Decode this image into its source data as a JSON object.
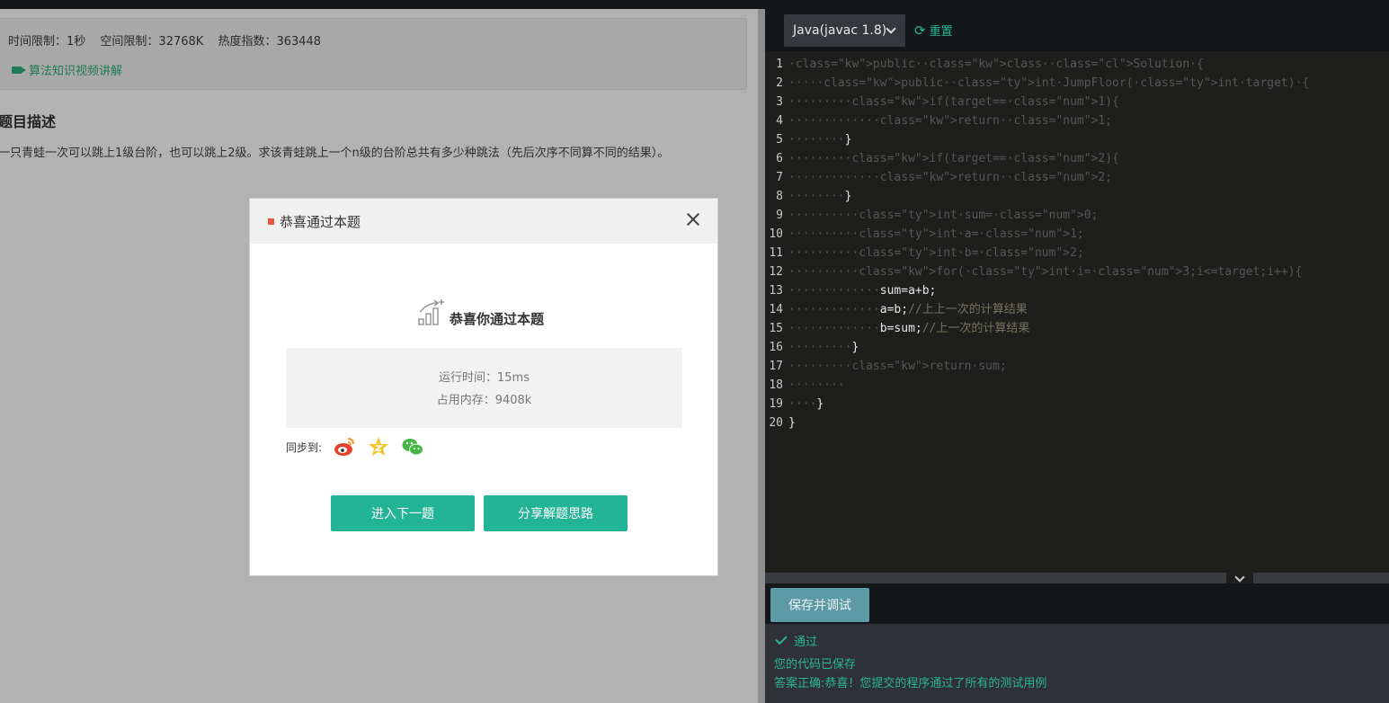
{
  "problem": {
    "time_limit": "时间限制：1秒",
    "space_limit": "空间限制：32768K",
    "heat": "热度指数：363448",
    "video_link": "算法知识视频讲解",
    "desc_title": "题目描述",
    "desc_text": "一只青蛙一次可以跳上1级台阶，也可以跳上2级。求该青蛙跳上一个n级的台阶总共有多少种跳法（先后次序不同算不同的结果）。"
  },
  "editor": {
    "language": "Java(javac 1.8)",
    "reset_label": "重置",
    "save_debug_label": "保存并调试",
    "lines": [
      "public class Solution {",
      "    public int JumpFloor(int target) {",
      "        if(target==1){",
      "            return 1;",
      "        }",
      "        if(target==2){",
      "            return 2;",
      "        }",
      "         int sum=0;",
      "         int a=1;",
      "         int b=2;",
      "         for(int i=3;i<=target;i++){",
      "             sum=a+b;",
      "             a=b;//上上一次的计算结果",
      "             b=sum;//上一次的计算结果",
      "         }",
      "        return sum;",
      "        ",
      "    }",
      "}"
    ]
  },
  "result": {
    "status": "通过",
    "saved": "您的代码已保存",
    "message": "答案正确:恭喜！您提交的程序通过了所有的测试用例"
  },
  "modal": {
    "title": "恭喜通过本题",
    "congrats": "恭喜你通过本题",
    "runtime": "运行时间：15ms",
    "memory": "占用内存：9408k",
    "sync_label": "同步到:",
    "next_button": "进入下一题",
    "share_button": "分享解题思路"
  },
  "colors": {
    "accent": "#23b495",
    "editor_bg": "#1e1f1c",
    "keyword": "#f92672",
    "type": "#66d9ef"
  }
}
